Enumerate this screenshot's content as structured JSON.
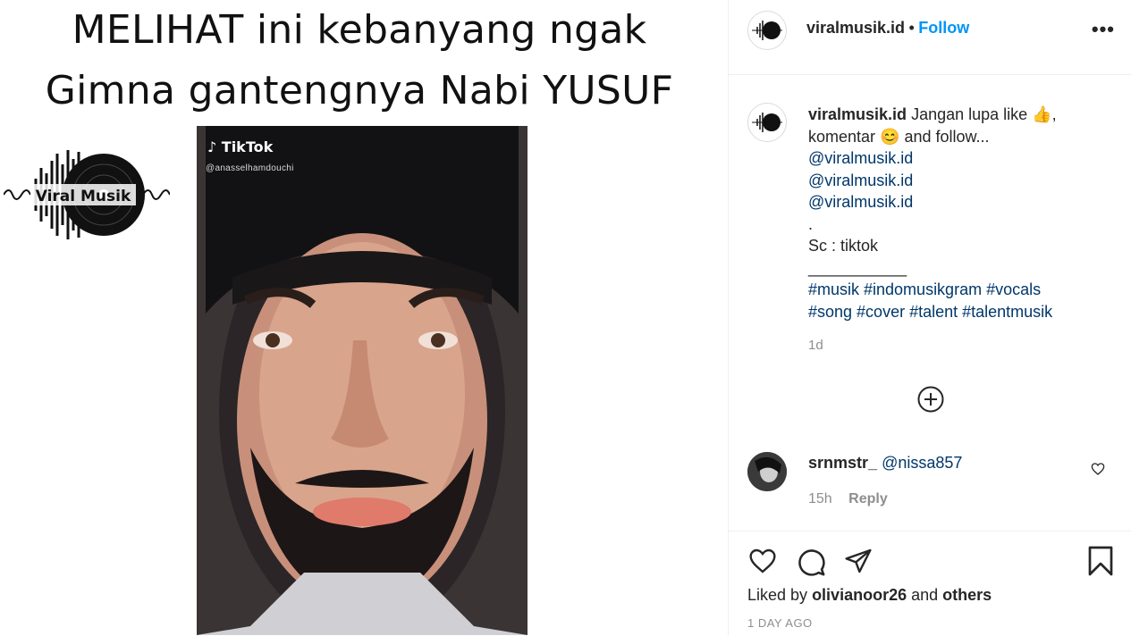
{
  "post_image": {
    "headline_line1": "MELIHAT ini kebanyang ngak",
    "headline_line2": "Gimna gantengnya Nabi YUSUF",
    "logo_text": "Viral Musik",
    "tiktok_label": "TikTok",
    "tiktok_handle": "@anasselhamdouchi"
  },
  "header": {
    "username": "viralmusik.id",
    "separator": "•",
    "follow_label": "Follow",
    "more_label": "•••"
  },
  "caption": {
    "username": "viralmusik.id",
    "text_line1": "Jangan lupa like 👍,",
    "text_line2": "komentar 😊 and follow...",
    "mentions": [
      "@viralmusik.id",
      "@viralmusik.id",
      "@viralmusik.id"
    ],
    "dot_line": ".",
    "source_line": "Sc : tiktok",
    "rule_line": "___________",
    "hashtags_line1": "#musik #indomusikgram #vocals",
    "hashtags_line2": "#song #cover #talent #talentmusik",
    "time": "1d"
  },
  "comment": {
    "username": "srnmstr_",
    "mention": "@nissa857",
    "time": "15h",
    "reply_label": "Reply"
  },
  "likes": {
    "prefix": "Liked by",
    "user": "olivianoor26",
    "and": "and",
    "others": "others"
  },
  "timestamp": "1 DAY AGO",
  "colors": {
    "follow": "#0095f6",
    "link": "#00376b",
    "muted": "#8e8e8e"
  }
}
